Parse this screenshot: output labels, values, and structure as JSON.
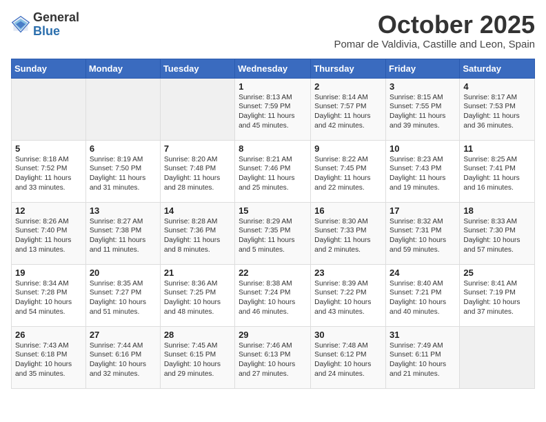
{
  "header": {
    "logo": {
      "general": "General",
      "blue": "Blue"
    },
    "month_title": "October 2025",
    "subtitle": "Pomar de Valdivia, Castille and Leon, Spain"
  },
  "weekdays": [
    "Sunday",
    "Monday",
    "Tuesday",
    "Wednesday",
    "Thursday",
    "Friday",
    "Saturday"
  ],
  "weeks": [
    [
      {
        "day": "",
        "info": ""
      },
      {
        "day": "",
        "info": ""
      },
      {
        "day": "",
        "info": ""
      },
      {
        "day": "1",
        "info": "Sunrise: 8:13 AM\nSunset: 7:59 PM\nDaylight: 11 hours and 45 minutes."
      },
      {
        "day": "2",
        "info": "Sunrise: 8:14 AM\nSunset: 7:57 PM\nDaylight: 11 hours and 42 minutes."
      },
      {
        "day": "3",
        "info": "Sunrise: 8:15 AM\nSunset: 7:55 PM\nDaylight: 11 hours and 39 minutes."
      },
      {
        "day": "4",
        "info": "Sunrise: 8:17 AM\nSunset: 7:53 PM\nDaylight: 11 hours and 36 minutes."
      }
    ],
    [
      {
        "day": "5",
        "info": "Sunrise: 8:18 AM\nSunset: 7:52 PM\nDaylight: 11 hours and 33 minutes."
      },
      {
        "day": "6",
        "info": "Sunrise: 8:19 AM\nSunset: 7:50 PM\nDaylight: 11 hours and 31 minutes."
      },
      {
        "day": "7",
        "info": "Sunrise: 8:20 AM\nSunset: 7:48 PM\nDaylight: 11 hours and 28 minutes."
      },
      {
        "day": "8",
        "info": "Sunrise: 8:21 AM\nSunset: 7:46 PM\nDaylight: 11 hours and 25 minutes."
      },
      {
        "day": "9",
        "info": "Sunrise: 8:22 AM\nSunset: 7:45 PM\nDaylight: 11 hours and 22 minutes."
      },
      {
        "day": "10",
        "info": "Sunrise: 8:23 AM\nSunset: 7:43 PM\nDaylight: 11 hours and 19 minutes."
      },
      {
        "day": "11",
        "info": "Sunrise: 8:25 AM\nSunset: 7:41 PM\nDaylight: 11 hours and 16 minutes."
      }
    ],
    [
      {
        "day": "12",
        "info": "Sunrise: 8:26 AM\nSunset: 7:40 PM\nDaylight: 11 hours and 13 minutes."
      },
      {
        "day": "13",
        "info": "Sunrise: 8:27 AM\nSunset: 7:38 PM\nDaylight: 11 hours and 11 minutes."
      },
      {
        "day": "14",
        "info": "Sunrise: 8:28 AM\nSunset: 7:36 PM\nDaylight: 11 hours and 8 minutes."
      },
      {
        "day": "15",
        "info": "Sunrise: 8:29 AM\nSunset: 7:35 PM\nDaylight: 11 hours and 5 minutes."
      },
      {
        "day": "16",
        "info": "Sunrise: 8:30 AM\nSunset: 7:33 PM\nDaylight: 11 hours and 2 minutes."
      },
      {
        "day": "17",
        "info": "Sunrise: 8:32 AM\nSunset: 7:31 PM\nDaylight: 10 hours and 59 minutes."
      },
      {
        "day": "18",
        "info": "Sunrise: 8:33 AM\nSunset: 7:30 PM\nDaylight: 10 hours and 57 minutes."
      }
    ],
    [
      {
        "day": "19",
        "info": "Sunrise: 8:34 AM\nSunset: 7:28 PM\nDaylight: 10 hours and 54 minutes."
      },
      {
        "day": "20",
        "info": "Sunrise: 8:35 AM\nSunset: 7:27 PM\nDaylight: 10 hours and 51 minutes."
      },
      {
        "day": "21",
        "info": "Sunrise: 8:36 AM\nSunset: 7:25 PM\nDaylight: 10 hours and 48 minutes."
      },
      {
        "day": "22",
        "info": "Sunrise: 8:38 AM\nSunset: 7:24 PM\nDaylight: 10 hours and 46 minutes."
      },
      {
        "day": "23",
        "info": "Sunrise: 8:39 AM\nSunset: 7:22 PM\nDaylight: 10 hours and 43 minutes."
      },
      {
        "day": "24",
        "info": "Sunrise: 8:40 AM\nSunset: 7:21 PM\nDaylight: 10 hours and 40 minutes."
      },
      {
        "day": "25",
        "info": "Sunrise: 8:41 AM\nSunset: 7:19 PM\nDaylight: 10 hours and 37 minutes."
      }
    ],
    [
      {
        "day": "26",
        "info": "Sunrise: 7:43 AM\nSunset: 6:18 PM\nDaylight: 10 hours and 35 minutes."
      },
      {
        "day": "27",
        "info": "Sunrise: 7:44 AM\nSunset: 6:16 PM\nDaylight: 10 hours and 32 minutes."
      },
      {
        "day": "28",
        "info": "Sunrise: 7:45 AM\nSunset: 6:15 PM\nDaylight: 10 hours and 29 minutes."
      },
      {
        "day": "29",
        "info": "Sunrise: 7:46 AM\nSunset: 6:13 PM\nDaylight: 10 hours and 27 minutes."
      },
      {
        "day": "30",
        "info": "Sunrise: 7:48 AM\nSunset: 6:12 PM\nDaylight: 10 hours and 24 minutes."
      },
      {
        "day": "31",
        "info": "Sunrise: 7:49 AM\nSunset: 6:11 PM\nDaylight: 10 hours and 21 minutes."
      },
      {
        "day": "",
        "info": ""
      }
    ]
  ]
}
